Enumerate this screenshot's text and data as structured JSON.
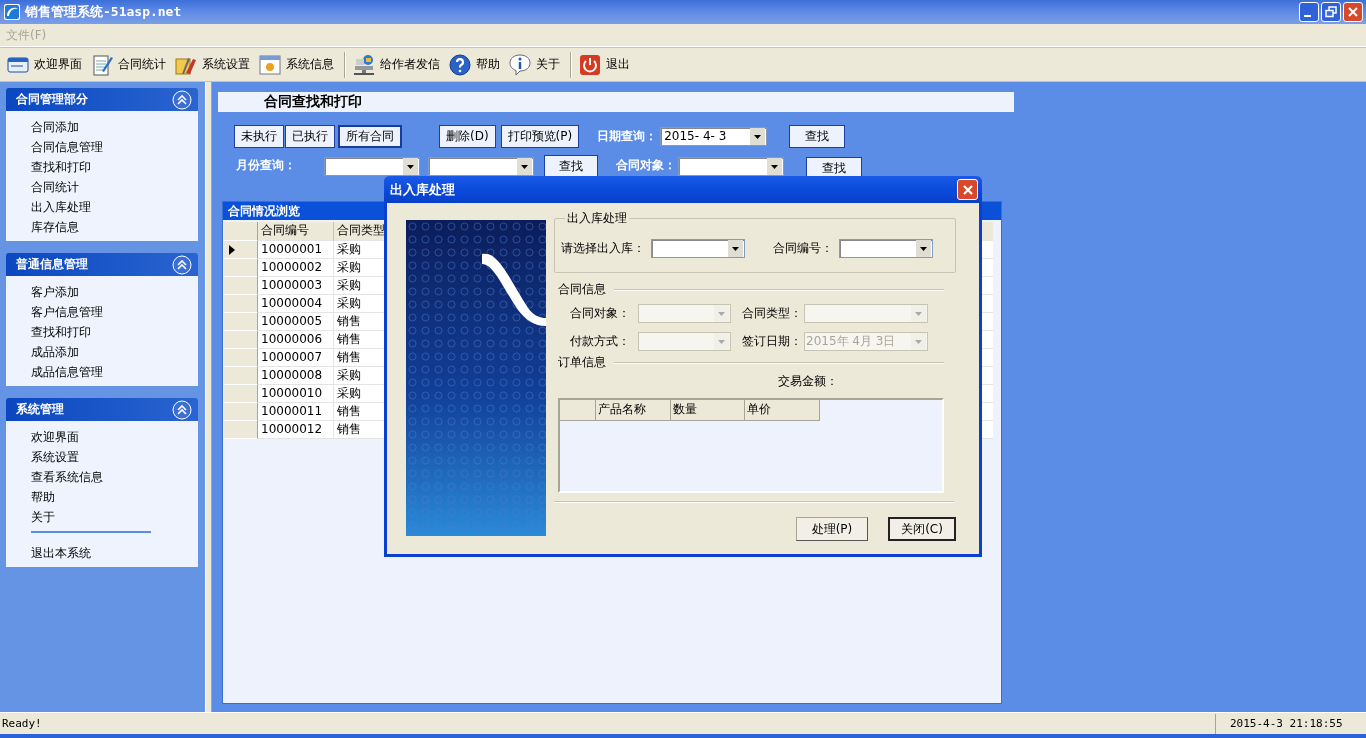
{
  "window": {
    "title": "销售管理系统-51asp.net"
  },
  "menu": [
    {
      "label": "文件(F)",
      "disabled": true
    }
  ],
  "toolbar": [
    {
      "label": "欢迎界面",
      "separator_before": false
    },
    {
      "label": "合同统计",
      "separator_before": false
    },
    {
      "label": "系统设置",
      "separator_before": false
    },
    {
      "label": "系统信息",
      "separator_before": false
    },
    {
      "label": "给作者发信",
      "separator_before": true
    },
    {
      "label": "帮助",
      "separator_before": false
    },
    {
      "label": "关于",
      "separator_before": false
    },
    {
      "label": "退出",
      "separator_before": true
    }
  ],
  "sidebar": [
    {
      "title": "合同管理部分",
      "expanded": true,
      "items": [
        {
          "label": "合同添加",
          "divider_before": false
        },
        {
          "label": "合同信息管理",
          "divider_before": false
        },
        {
          "label": "查找和打印",
          "divider_before": false
        },
        {
          "label": "合同统计",
          "divider_before": false
        },
        {
          "label": "出入库处理",
          "divider_before": false
        },
        {
          "label": "库存信息",
          "divider_before": false
        }
      ]
    },
    {
      "title": "普通信息管理",
      "expanded": true,
      "items": [
        {
          "label": "客户添加",
          "divider_before": false
        },
        {
          "label": "客户信息管理",
          "divider_before": false
        },
        {
          "label": "查找和打印",
          "divider_before": false
        },
        {
          "label": "成品添加",
          "divider_before": false
        },
        {
          "label": "成品信息管理",
          "divider_before": false
        }
      ]
    },
    {
      "title": "系统管理",
      "expanded": true,
      "items": [
        {
          "label": "欢迎界面",
          "divider_before": false
        },
        {
          "label": "系统设置",
          "divider_before": false
        },
        {
          "label": "查看系统信息",
          "divider_before": false
        },
        {
          "label": "帮助",
          "divider_before": false
        },
        {
          "label": "关于",
          "divider_before": false
        },
        {
          "label": "退出本系统",
          "divider_before": true
        }
      ]
    }
  ],
  "page": {
    "title": "合同查找和打印",
    "filter_tabs": [
      {
        "label": "未执行",
        "selected": false
      },
      {
        "label": "已执行",
        "selected": false
      },
      {
        "label": "所有合同",
        "selected": true
      }
    ],
    "actions": [
      "删除(D)",
      "打印预览(P)"
    ],
    "date_query": {
      "label": "日期查询：",
      "value": "2015- 4- 3",
      "button": "查找"
    },
    "month_query": {
      "label": "月份查询：",
      "button": "查找"
    },
    "party_query": {
      "label": "合同对象：",
      "button": "查找"
    },
    "grid": {
      "title": "合同情况浏览",
      "columns": [
        "合同编号",
        "合同类型"
      ],
      "rows": [
        {
          "cells": [
            "10000001",
            "采购"
          ],
          "selected": true
        },
        {
          "cells": [
            "10000002",
            "采购"
          ],
          "selected": false
        },
        {
          "cells": [
            "10000003",
            "采购"
          ],
          "selected": false
        },
        {
          "cells": [
            "10000004",
            "采购"
          ],
          "selected": false
        },
        {
          "cells": [
            "10000005",
            "销售"
          ],
          "selected": false
        },
        {
          "cells": [
            "10000006",
            "销售"
          ],
          "selected": false
        },
        {
          "cells": [
            "10000007",
            "销售"
          ],
          "selected": false
        },
        {
          "cells": [
            "10000008",
            "采购"
          ],
          "selected": false
        },
        {
          "cells": [
            "10000010",
            "采购"
          ],
          "selected": false
        },
        {
          "cells": [
            "10000011",
            "销售"
          ],
          "selected": false
        },
        {
          "cells": [
            "10000012",
            "销售"
          ],
          "selected": false
        }
      ]
    }
  },
  "dialog": {
    "title": "出入库处理",
    "group": {
      "title": "出入库处理",
      "fields": [
        {
          "label": "请选择出入库："
        },
        {
          "label": "合同编号："
        }
      ]
    },
    "contract_section": "合同信息",
    "contract_fields": [
      {
        "label": "合同对象：",
        "disabled": true
      },
      {
        "label": "合同类型：",
        "disabled": true
      },
      {
        "label": "付款方式：",
        "disabled": true
      },
      {
        "label": "签订日期：",
        "value": "2015年 4月 3日",
        "disabled": true
      }
    ],
    "order_section": "订单信息",
    "amount_label": "交易金额：",
    "order_columns": [
      "产品名称",
      "数量",
      "单价"
    ],
    "buttons": [
      {
        "label": "处理(P)",
        "default": false
      },
      {
        "label": "关闭(C)",
        "default": true
      }
    ]
  },
  "status_bar": {
    "message": "Ready!",
    "clock": "2015-4-3 21:18:55"
  }
}
